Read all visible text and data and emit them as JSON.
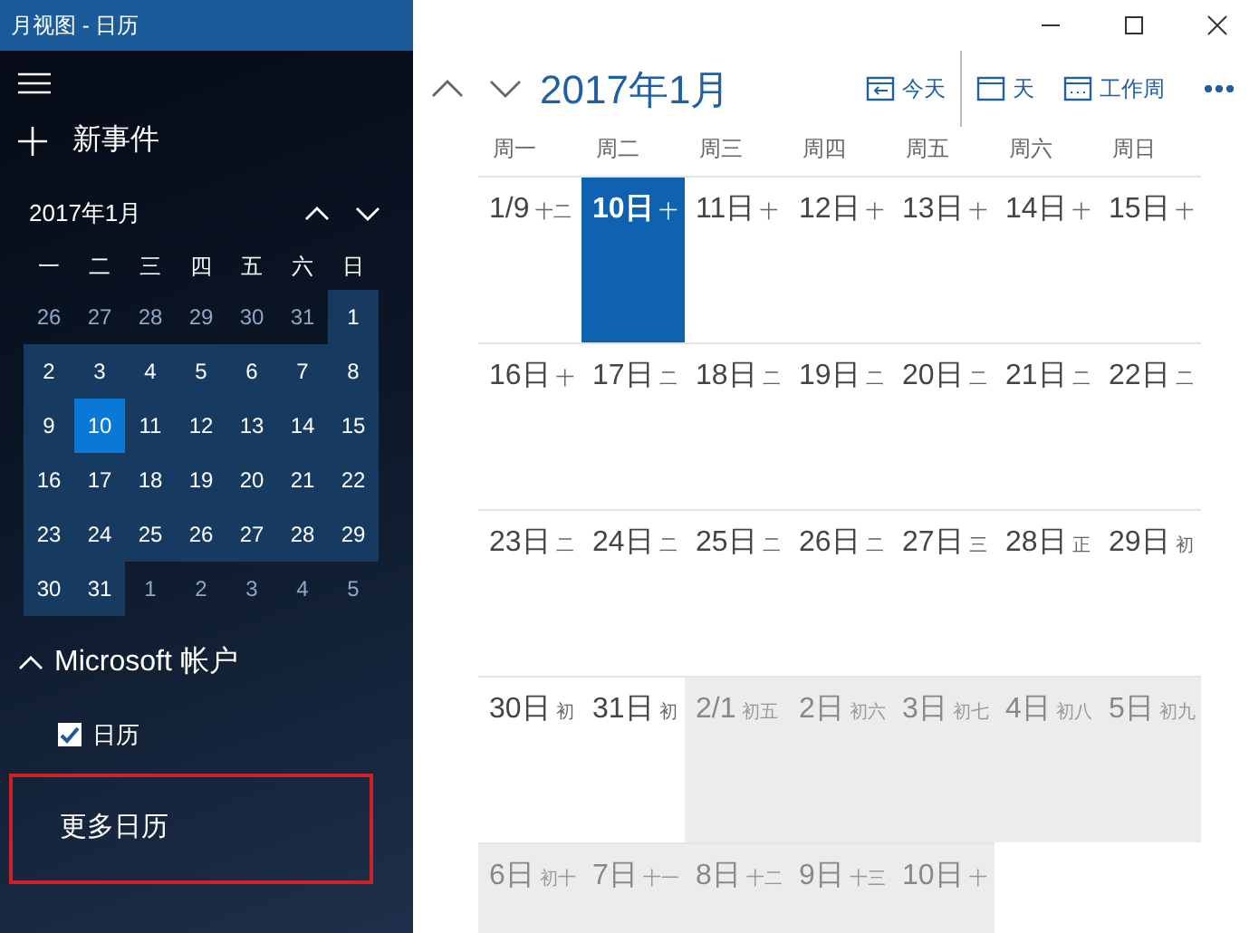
{
  "window": {
    "title": "月视图 - 日历"
  },
  "sidebar": {
    "new_event": "新事件",
    "mini_calendar": {
      "title": "2017年1月",
      "weekdays": [
        "一",
        "二",
        "三",
        "四",
        "五",
        "六",
        "日"
      ],
      "days": [
        {
          "label": "26",
          "current_month": false,
          "selected": false
        },
        {
          "label": "27",
          "current_month": false,
          "selected": false
        },
        {
          "label": "28",
          "current_month": false,
          "selected": false
        },
        {
          "label": "29",
          "current_month": false,
          "selected": false
        },
        {
          "label": "30",
          "current_month": false,
          "selected": false
        },
        {
          "label": "31",
          "current_month": false,
          "selected": false
        },
        {
          "label": "1",
          "current_month": true,
          "selected": false
        },
        {
          "label": "2",
          "current_month": true,
          "selected": false
        },
        {
          "label": "3",
          "current_month": true,
          "selected": false
        },
        {
          "label": "4",
          "current_month": true,
          "selected": false
        },
        {
          "label": "5",
          "current_month": true,
          "selected": false
        },
        {
          "label": "6",
          "current_month": true,
          "selected": false
        },
        {
          "label": "7",
          "current_month": true,
          "selected": false
        },
        {
          "label": "8",
          "current_month": true,
          "selected": false
        },
        {
          "label": "9",
          "current_month": true,
          "selected": false
        },
        {
          "label": "10",
          "current_month": true,
          "selected": true
        },
        {
          "label": "11",
          "current_month": true,
          "selected": false
        },
        {
          "label": "12",
          "current_month": true,
          "selected": false
        },
        {
          "label": "13",
          "current_month": true,
          "selected": false
        },
        {
          "label": "14",
          "current_month": true,
          "selected": false
        },
        {
          "label": "15",
          "current_month": true,
          "selected": false
        },
        {
          "label": "16",
          "current_month": true,
          "selected": false
        },
        {
          "label": "17",
          "current_month": true,
          "selected": false
        },
        {
          "label": "18",
          "current_month": true,
          "selected": false
        },
        {
          "label": "19",
          "current_month": true,
          "selected": false
        },
        {
          "label": "20",
          "current_month": true,
          "selected": false
        },
        {
          "label": "21",
          "current_month": true,
          "selected": false
        },
        {
          "label": "22",
          "current_month": true,
          "selected": false
        },
        {
          "label": "23",
          "current_month": true,
          "selected": false
        },
        {
          "label": "24",
          "current_month": true,
          "selected": false
        },
        {
          "label": "25",
          "current_month": true,
          "selected": false
        },
        {
          "label": "26",
          "current_month": true,
          "selected": false
        },
        {
          "label": "27",
          "current_month": true,
          "selected": false
        },
        {
          "label": "28",
          "current_month": true,
          "selected": false
        },
        {
          "label": "29",
          "current_month": true,
          "selected": false
        },
        {
          "label": "30",
          "current_month": true,
          "selected": false
        },
        {
          "label": "31",
          "current_month": true,
          "selected": false
        },
        {
          "label": "1",
          "current_month": false,
          "selected": false
        },
        {
          "label": "2",
          "current_month": false,
          "selected": false
        },
        {
          "label": "3",
          "current_month": false,
          "selected": false
        },
        {
          "label": "4",
          "current_month": false,
          "selected": false
        },
        {
          "label": "5",
          "current_month": false,
          "selected": false
        }
      ]
    },
    "account": {
      "name": "Microsoft 帐户",
      "expanded": true,
      "calendars": [
        {
          "label": "日历",
          "checked": true
        }
      ]
    },
    "more_calendars": {
      "label": "更多日历",
      "highlighted": true
    }
  },
  "main": {
    "title": "2017年1月",
    "toolbar": [
      {
        "label": "今天",
        "kind": "today"
      },
      {
        "label": "天",
        "kind": "day"
      },
      {
        "label": "工作周",
        "kind": "workweek"
      }
    ],
    "weekdays": [
      "周一",
      "周二",
      "周三",
      "周四",
      "周五",
      "周六",
      "周日"
    ],
    "weeks": [
      [
        {
          "date": "1/9",
          "lunar": "十二",
          "today": false,
          "current_month": true
        },
        {
          "date": "10日",
          "lunar": "十",
          "today": true,
          "current_month": true
        },
        {
          "date": "11日",
          "lunar": "十",
          "today": false,
          "current_month": true
        },
        {
          "date": "12日",
          "lunar": "十",
          "today": false,
          "current_month": true
        },
        {
          "date": "13日",
          "lunar": "十",
          "today": false,
          "current_month": true
        },
        {
          "date": "14日",
          "lunar": "十",
          "today": false,
          "current_month": true
        },
        {
          "date": "15日",
          "lunar": "十",
          "today": false,
          "current_month": true
        }
      ],
      [
        {
          "date": "16日",
          "lunar": "十",
          "today": false,
          "current_month": true
        },
        {
          "date": "17日",
          "lunar": "二",
          "today": false,
          "current_month": true
        },
        {
          "date": "18日",
          "lunar": "二",
          "today": false,
          "current_month": true
        },
        {
          "date": "19日",
          "lunar": "二",
          "today": false,
          "current_month": true
        },
        {
          "date": "20日",
          "lunar": "二",
          "today": false,
          "current_month": true
        },
        {
          "date": "21日",
          "lunar": "二",
          "today": false,
          "current_month": true
        },
        {
          "date": "22日",
          "lunar": "二",
          "today": false,
          "current_month": true
        }
      ],
      [
        {
          "date": "23日",
          "lunar": "二",
          "today": false,
          "current_month": true
        },
        {
          "date": "24日",
          "lunar": "二",
          "today": false,
          "current_month": true
        },
        {
          "date": "25日",
          "lunar": "二",
          "today": false,
          "current_month": true
        },
        {
          "date": "26日",
          "lunar": "二",
          "today": false,
          "current_month": true
        },
        {
          "date": "27日",
          "lunar": "三",
          "today": false,
          "current_month": true
        },
        {
          "date": "28日",
          "lunar": "正",
          "today": false,
          "current_month": true
        },
        {
          "date": "29日",
          "lunar": "初",
          "today": false,
          "current_month": true
        }
      ],
      [
        {
          "date": "30日",
          "lunar": "初",
          "today": false,
          "current_month": true
        },
        {
          "date": "31日",
          "lunar": "初",
          "today": false,
          "current_month": true
        },
        {
          "date": "2/1",
          "lunar": "初五",
          "today": false,
          "current_month": false
        },
        {
          "date": "2日",
          "lunar": "初六",
          "today": false,
          "current_month": false
        },
        {
          "date": "3日",
          "lunar": "初七",
          "today": false,
          "current_month": false
        },
        {
          "date": "4日",
          "lunar": "初八",
          "today": false,
          "current_month": false
        },
        {
          "date": "5日",
          "lunar": "初九",
          "today": false,
          "current_month": false
        }
      ],
      [
        {
          "date": "6日",
          "lunar": "初十",
          "today": false,
          "current_month": false
        },
        {
          "date": "7日",
          "lunar": "十一",
          "today": false,
          "current_month": false
        },
        {
          "date": "8日",
          "lunar": "十二",
          "today": false,
          "current_month": false
        },
        {
          "date": "9日",
          "lunar": "十三",
          "today": false,
          "current_month": false
        },
        {
          "date": "10日",
          "lunar": "十",
          "today": false,
          "current_month": false
        }
      ]
    ]
  }
}
